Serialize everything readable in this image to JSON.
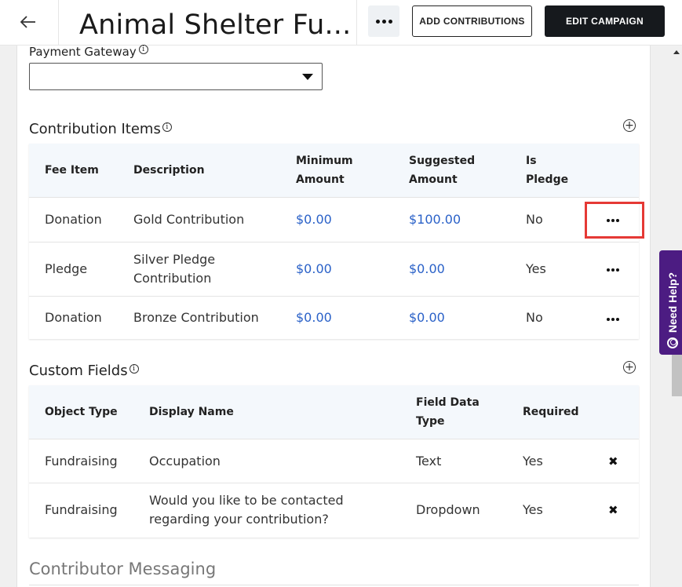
{
  "header": {
    "title": "Animal Shelter Fu...",
    "add_contributions_label": "ADD CONTRIBUTIONS",
    "edit_campaign_label": "EDIT CAMPAIGN"
  },
  "payment_gateway": {
    "label": "Payment Gateway",
    "value": ""
  },
  "contribution_items": {
    "title": "Contribution Items",
    "headers": {
      "fee_item": "Fee Item",
      "description": "Description",
      "minimum_amount_1": "Minimum",
      "minimum_amount_2": "Amount",
      "suggested_amount_1": "Suggested",
      "suggested_amount_2": "Amount",
      "is_pledge_1": "Is",
      "is_pledge_2": "Pledge"
    },
    "rows": [
      {
        "fee_item": "Donation",
        "description_1": "Gold Contribution",
        "description_2": "",
        "minimum": "$0.00",
        "suggested": "$100.00",
        "is_pledge": "No"
      },
      {
        "fee_item": "Pledge",
        "description_1": "Silver Pledge",
        "description_2": "Contribution",
        "minimum": "$0.00",
        "suggested": "$0.00",
        "is_pledge": "Yes"
      },
      {
        "fee_item": "Donation",
        "description_1": "Bronze Contribution",
        "description_2": "",
        "minimum": "$0.00",
        "suggested": "$0.00",
        "is_pledge": "No"
      }
    ]
  },
  "custom_fields": {
    "title": "Custom Fields",
    "headers": {
      "object_type": "Object Type",
      "display_name": "Display Name",
      "field_data_type_1": "Field Data",
      "field_data_type_2": "Type",
      "required": "Required"
    },
    "rows": [
      {
        "object_type": "Fundraising",
        "display_name_1": "Occupation",
        "display_name_2": "",
        "field_data_type": "Text",
        "required": "Yes"
      },
      {
        "object_type": "Fundraising",
        "display_name_1": "Would you like to be contacted",
        "display_name_2": "regarding your contribution?",
        "field_data_type": "Dropdown",
        "required": "Yes"
      }
    ]
  },
  "contributor_messaging": {
    "title": "Contributor Messaging"
  },
  "help_tab": {
    "label": "Need Help?"
  },
  "colors": {
    "accent_link": "#2a61c8",
    "help_tab": "#4c1c82",
    "highlight": "#e53935",
    "primary_button": "#16191d"
  }
}
